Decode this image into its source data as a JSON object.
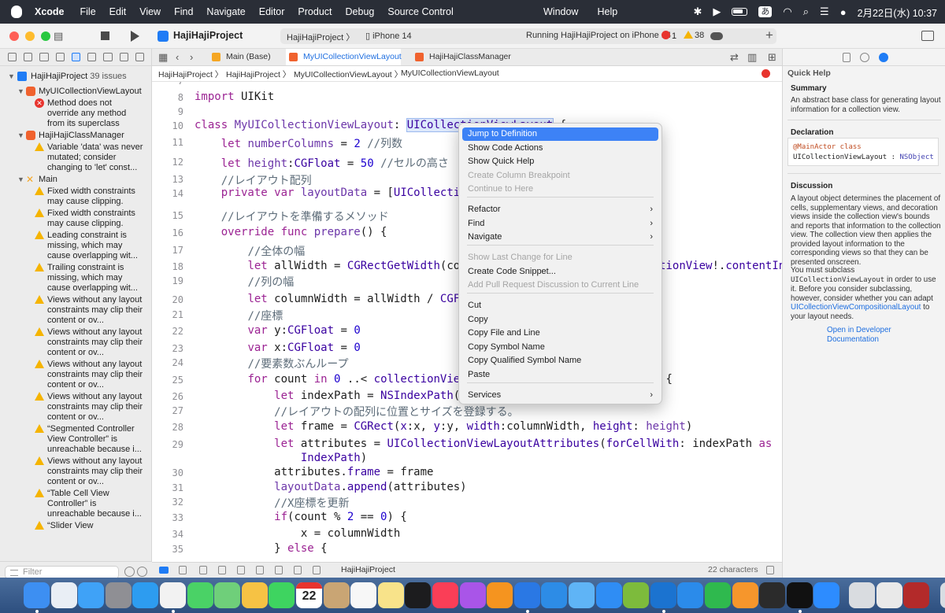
{
  "menubar": {
    "app": "Xcode",
    "items": [
      "File",
      "Edit",
      "View",
      "Find",
      "Navigate",
      "Editor",
      "Product",
      "Debug",
      "Source Control"
    ],
    "extra": [
      "Window",
      "Help"
    ],
    "input_method": "あ",
    "clock": "2月22日(水)  10:37"
  },
  "toolbar": {
    "project": "HajiHajiProject",
    "scheme_project": "HajiHajiProject 〉",
    "device": "iPhone 14",
    "status": "Running HajiHajiProject on iPhone 14",
    "errors": "1",
    "warnings": "38"
  },
  "navigator": {
    "root": "HajiHajiProject",
    "root_count": "39 issues",
    "rows": [
      {
        "kind": "file",
        "text": "MyUICollectionViewLayout"
      },
      {
        "kind": "error",
        "text": "Method does not override any method from its superclass"
      },
      {
        "kind": "file",
        "text": "HajiHajiClassManager"
      },
      {
        "kind": "warning",
        "text": "Variable 'data' was never mutated; consider changing to 'let' const..."
      },
      {
        "kind": "folder",
        "text": "Main"
      },
      {
        "kind": "warning",
        "text": "Fixed width constraints may cause clipping."
      },
      {
        "kind": "warning",
        "text": "Fixed width constraints may cause clipping."
      },
      {
        "kind": "warning",
        "text": "Leading constraint is missing, which may cause overlapping wit..."
      },
      {
        "kind": "warning",
        "text": "Trailing constraint is missing, which may cause overlapping wit..."
      },
      {
        "kind": "warning",
        "text": "Views without any layout constraints may clip their content or ov..."
      },
      {
        "kind": "warning",
        "text": "Views without any layout constraints may clip their content or ov..."
      },
      {
        "kind": "warning",
        "text": "Views without any layout constraints may clip their content or ov..."
      },
      {
        "kind": "warning",
        "text": "Views without any layout constraints may clip their content or ov..."
      },
      {
        "kind": "warning",
        "text": "“Segmented Controller View Controller” is unreachable because i..."
      },
      {
        "kind": "warning",
        "text": "Views without any layout constraints may clip their content or ov..."
      },
      {
        "kind": "warning",
        "text": "“Table Cell View Controller” is unreachable because i..."
      },
      {
        "kind": "warning",
        "text": "“Slider View"
      }
    ],
    "filter_placeholder": "Filter"
  },
  "tabs": [
    {
      "label": "Main (Base)",
      "active": false
    },
    {
      "label": "MyUICollectionViewLayout",
      "active": true
    },
    {
      "label": "HajiHajiClassManager",
      "active": false
    }
  ],
  "jumpbar": [
    "HajiHajiProject 〉",
    "HajiHajiProject 〉",
    "MyUICollectionViewLayout 〉",
    "MyUICollectionViewLayout"
  ],
  "code": {
    "lines": [
      {
        "n": "7",
        "html": ""
      },
      {
        "n": "8",
        "html": "<span class=\"kw\">import</span> UIKit"
      },
      {
        "n": "9",
        "html": ""
      },
      {
        "n": "10",
        "html": "<span class=\"kw\">class</span> <span class=\"ty\">MyUICollectionViewLayout</span>: <span class=\"id sel-hl\">UICollectionViewLayout</span> {"
      },
      {
        "n": "11",
        "html": "    <span class=\"kw\">let</span> <span class=\"ty\">numberColumns</span> = <span class=\"num\">2</span> <span class=\"cm\">//列数</span>"
      },
      {
        "n": "12",
        "html": "    <span class=\"kw\">let</span> <span class=\"ty\">height</span>:<span class=\"id\">CGFloat</span> = <span class=\"num\">50</span> <span class=\"cm\">//セルの高さ</span>"
      },
      {
        "n": "13",
        "html": "    <span class=\"cm\">//レイアウト配列</span>"
      },
      {
        "n": "14",
        "html": "    <span class=\"kw\">private var</span> <span class=\"ty\">layoutData</span> = [<span class=\"id\">UICollectionViewLayoutAttributes</span>]()"
      },
      {
        "n": "15",
        "html": "    <span class=\"cm\">//レイアウトを準備するメソッド</span>"
      },
      {
        "n": "16",
        "html": "    <span class=\"kw\">override func</span> <span class=\"ty\">prepare</span>() {"
      },
      {
        "n": "17",
        "html": "        <span class=\"cm\">//全体の幅</span>"
      },
      {
        "n": "18",
        "html": "        <span class=\"kw\">let</span> allWidth = <span class=\"id\">CGRectGetWidth</span>(collectionView!.bounds) - <span class=\"id\">collectionView</span>!.<span class=\"id\">contentInset</span>.<span class=\"id\">left</span> - <span class=\"id\">collectionView</span>!.<span class=\"id\">contentInset</span>.<span class=\"id\">right</span>"
      },
      {
        "n": "19",
        "html": "        <span class=\"cm\">//列の幅</span>"
      },
      {
        "n": "20",
        "html": "        <span class=\"kw\">let</span> columnWidth = allWidth / <span class=\"id\">CGFloat</span>(numberColumns)"
      },
      {
        "n": "21",
        "html": "        <span class=\"cm\">//座標</span>"
      },
      {
        "n": "22",
        "html": "        <span class=\"kw\">var</span> y:<span class=\"id\">CGFloat</span> = <span class=\"num\">0</span>"
      },
      {
        "n": "23",
        "html": "        <span class=\"kw\">var</span> x:<span class=\"id\">CGFloat</span> = <span class=\"num\">0</span>"
      },
      {
        "n": "24",
        "html": "        <span class=\"cm\">//要素数ぶんループ</span>"
      },
      {
        "n": "25",
        "html": "        <span class=\"kw\">for</span> count <span class=\"kw\">in</span> <span class=\"num\">0</span> ..&lt; <span class=\"id\">collectionView</span>!.<span class=\"id\">numberOfItems</span>(inSection: <span class=\"num\">0</span>) {"
      },
      {
        "n": "26",
        "html": "            <span class=\"kw\">let</span> indexPath = <span class=\"id\">NSIndexPath</span>(<span class=\"id\">item</span>:count, <span class=\"id\">section</span>:<span class=\"num\">0</span>)"
      },
      {
        "n": "27",
        "html": "            <span class=\"cm\">//レイアウトの配列に位置とサイズを登録する。</span>"
      },
      {
        "n": "28",
        "html": "            <span class=\"kw\">let</span> frame = <span class=\"id\">CGRect</span>(<span class=\"id\">x</span>:x, <span class=\"id\">y</span>:y, <span class=\"id\">width</span>:columnWidth, <span class=\"id\">height</span>: <span class=\"ty\">height</span>)"
      },
      {
        "n": "29",
        "html": "            <span class=\"kw\">let</span> attributes = <span class=\"id\">UICollectionViewLayoutAttributes</span>(<span class=\"id\">forCellWith</span>: indexPath <span class=\"kw\">as</span>"
      },
      {
        "n": "",
        "html": "                <span class=\"id\">IndexPath</span>)"
      },
      {
        "n": "30",
        "html": "            attributes.<span class=\"id\">frame</span> = frame"
      },
      {
        "n": "31",
        "html": "            <span class=\"ty\">layoutData</span>.<span class=\"id\">append</span>(attributes)"
      },
      {
        "n": "32",
        "html": "            <span class=\"cm\">//X座標を更新</span>"
      },
      {
        "n": "33",
        "html": "            <span class=\"kw\">if</span>(count % <span class=\"num\">2</span> == <span class=\"num\">0</span>) {"
      },
      {
        "n": "34",
        "html": "                x = columnWidth"
      },
      {
        "n": "35",
        "html": "            } <span class=\"kw\">else</span> {"
      }
    ]
  },
  "context_menu": [
    {
      "label": "Jump to Definition",
      "state": "highlighted"
    },
    {
      "label": "Show Code Actions",
      "state": "enabled"
    },
    {
      "label": "Show Quick Help",
      "state": "enabled"
    },
    {
      "label": "Create Column Breakpoint",
      "state": "disabled"
    },
    {
      "label": "Continue to Here",
      "state": "disabled"
    },
    {
      "label": "Refactor",
      "state": "enabled",
      "submenu": true
    },
    {
      "label": "Find",
      "state": "enabled",
      "submenu": true
    },
    {
      "label": "Navigate",
      "state": "enabled",
      "submenu": true
    },
    {
      "label": "Show Last Change for Line",
      "state": "disabled"
    },
    {
      "label": "Create Code Snippet...",
      "state": "enabled"
    },
    {
      "label": "Add Pull Request Discussion to Current Line",
      "state": "disabled"
    },
    {
      "label": "Cut",
      "state": "enabled"
    },
    {
      "label": "Copy",
      "state": "enabled"
    },
    {
      "label": "Copy File and Line",
      "state": "enabled"
    },
    {
      "label": "Copy Symbol Name",
      "state": "enabled"
    },
    {
      "label": "Copy Qualified Symbol Name",
      "state": "enabled"
    },
    {
      "label": "Paste",
      "state": "enabled"
    },
    {
      "label": "Services",
      "state": "enabled",
      "submenu": true
    }
  ],
  "quick_help": {
    "title": "Quick Help",
    "summary_head": "Summary",
    "summary": "An abstract base class for generating layout information for a collection view.",
    "decl_head": "Declaration",
    "decl_attr": "@MainActor class",
    "decl_name": "UICollectionViewLayout :",
    "decl_super": "NSObject",
    "disc_head": "Discussion",
    "disc_p1": "A layout object determines the placement of cells, supplementary views, and decoration views inside the collection view's bounds and reports that information to the collection view. The collection view then applies the provided layout information to the corresponding views so that they can be presented onscreen.",
    "disc_p2a": "You must subclass",
    "disc_p2_code": "UICollectionViewLayout",
    "disc_p2b": "in order to use it. Before you consider subclassing, however, consider whether you can adapt",
    "disc_p2_link": "UICollectionViewCompositionalLayout",
    "disc_p2c": "to your layout needs.",
    "doc_link": "Open in Developer Documentation"
  },
  "debugbar": {
    "project": "HajiHajiProject",
    "chars": "22 characters"
  },
  "dock": {
    "calendar_day": "22",
    "apps": [
      {
        "name": "finder-icon",
        "color": "#3d8ff2"
      },
      {
        "name": "launchpad-icon",
        "color": "#e9eef5"
      },
      {
        "name": "mail-icon",
        "color": "#3fa2f7"
      },
      {
        "name": "system-settings-icon",
        "color": "#8f8f94"
      },
      {
        "name": "safari-icon",
        "color": "#2d9cf0"
      },
      {
        "name": "chrome-icon",
        "color": "#f2f2f2"
      },
      {
        "name": "messages-icon",
        "color": "#4ad266"
      },
      {
        "name": "maps-icon",
        "color": "#6fcf7a"
      },
      {
        "name": "photos-icon",
        "color": "#f6c244"
      },
      {
        "name": "facetime-icon",
        "color": "#3ed460"
      },
      {
        "name": "calendar-icon",
        "color": "#ffffff"
      },
      {
        "name": "contacts-icon",
        "color": "#c9a574"
      },
      {
        "name": "reminders-icon",
        "color": "#f7f7f7"
      },
      {
        "name": "notes-icon",
        "color": "#f8e38a"
      },
      {
        "name": "tv-icon",
        "color": "#1c1c1e"
      },
      {
        "name": "music-icon",
        "color": "#fa3e57"
      },
      {
        "name": "podcasts-icon",
        "color": "#a955e8"
      },
      {
        "name": "books-icon",
        "color": "#f5941f"
      },
      {
        "name": "xcode-icon",
        "color": "#2a78e4"
      },
      {
        "name": "instruments-icon",
        "color": "#2d8ce6"
      },
      {
        "name": "simulator-icon",
        "color": "#5fb4f6"
      },
      {
        "name": "app-store-icon",
        "color": "#2f8df4"
      },
      {
        "name": "sketch-icon",
        "color": "#7dbb3c"
      },
      {
        "name": "vscode-icon",
        "color": "#1b73d0"
      },
      {
        "name": "keynote-icon",
        "color": "#2b8bea"
      },
      {
        "name": "numbers-icon",
        "color": "#2fb94e"
      },
      {
        "name": "pages-icon",
        "color": "#f6962c"
      },
      {
        "name": "activity-monitor-icon",
        "color": "#2b2b2b"
      },
      {
        "name": "terminal-icon",
        "color": "#111111"
      },
      {
        "name": "zoom-icon",
        "color": "#2d8cff"
      },
      {
        "name": "storage-icon",
        "color": "#d9dce0"
      },
      {
        "name": "script-editor-icon",
        "color": "#e9e9e9"
      },
      {
        "name": "dictionary-icon",
        "color": "#b32a2a"
      },
      {
        "name": "trash-icon",
        "color": "#d8dde3"
      }
    ]
  }
}
